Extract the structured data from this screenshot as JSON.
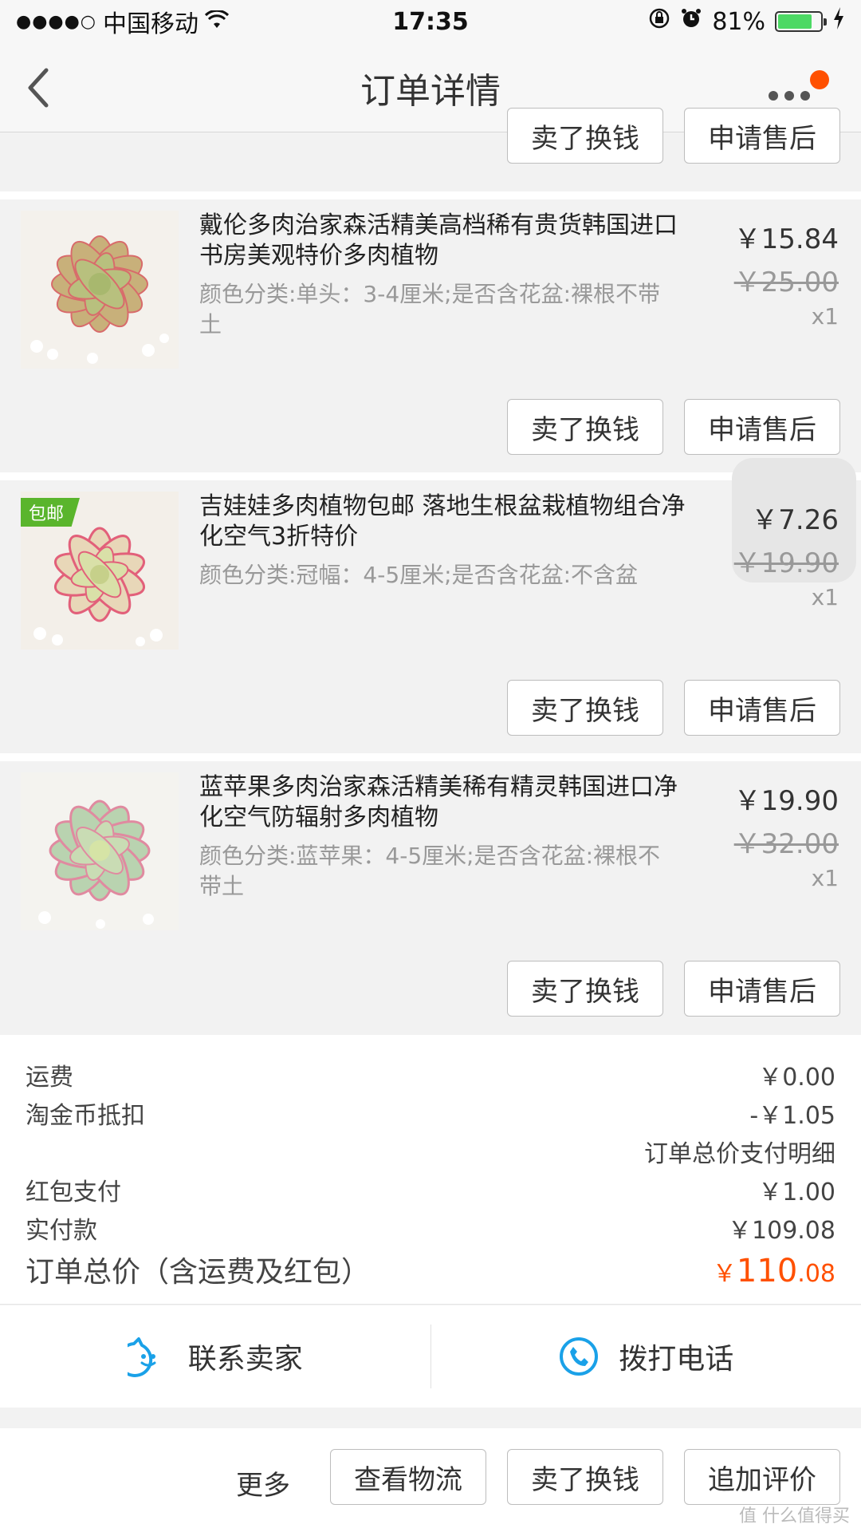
{
  "status_bar": {
    "signal": "●●●●○",
    "carrier": "中国移动",
    "time": "17:35",
    "battery_percent": "81%",
    "battery_level": 0.81
  },
  "nav": {
    "title": "订单详情"
  },
  "actions": {
    "sell": "卖了换钱",
    "after_sale": "申请售后"
  },
  "items": [
    {
      "title": "戴伦多肉治家森活精美高档稀有贵货韩国进口书房美观特价多肉植物",
      "sku": "颜色分类:单头：3-4厘米;是否含花盆:裸根不带土",
      "price": "￥15.84",
      "old_price": "￥25.00",
      "qty": "x1"
    },
    {
      "badge": "包邮",
      "title": "吉娃娃多肉植物包邮 落地生根盆栽植物组合净化空气3折特价",
      "sku": "颜色分类:冠幅：4-5厘米;是否含花盆:不含盆",
      "price": "￥7.26",
      "old_price": "￥19.90",
      "qty": "x1"
    },
    {
      "title": "蓝苹果多肉治家森活精美稀有精灵韩国进口净化空气防辐射多肉植物",
      "sku": "颜色分类:蓝苹果：4-5厘米;是否含花盆:裸根不带土",
      "price": "￥19.90",
      "old_price": "￥32.00",
      "qty": "x1"
    }
  ],
  "summary": {
    "shipping_label": "运费",
    "shipping_value": "￥0.00",
    "coin_label": "淘金币抵扣",
    "coin_value": "-￥1.05",
    "detail_link": "订单总价支付明细",
    "redpack_label": "红包支付",
    "redpack_value": "￥1.00",
    "paid_label": "实付款",
    "paid_value": "￥109.08",
    "total_label": "订单总价（含运费及红包）",
    "total_currency": "￥",
    "total_int": "110",
    "total_dec": ".08"
  },
  "contact": {
    "seller": "联系卖家",
    "phone": "拨打电话"
  },
  "bottom": {
    "more": "更多",
    "logistics": "查看物流",
    "sell": "卖了换钱",
    "review": "追加评价"
  },
  "watermark": "值 什么值得买",
  "colors": {
    "accent": "#ff5000",
    "badge_green": "#5ab52c",
    "icon_blue": "#1aa1e8"
  }
}
